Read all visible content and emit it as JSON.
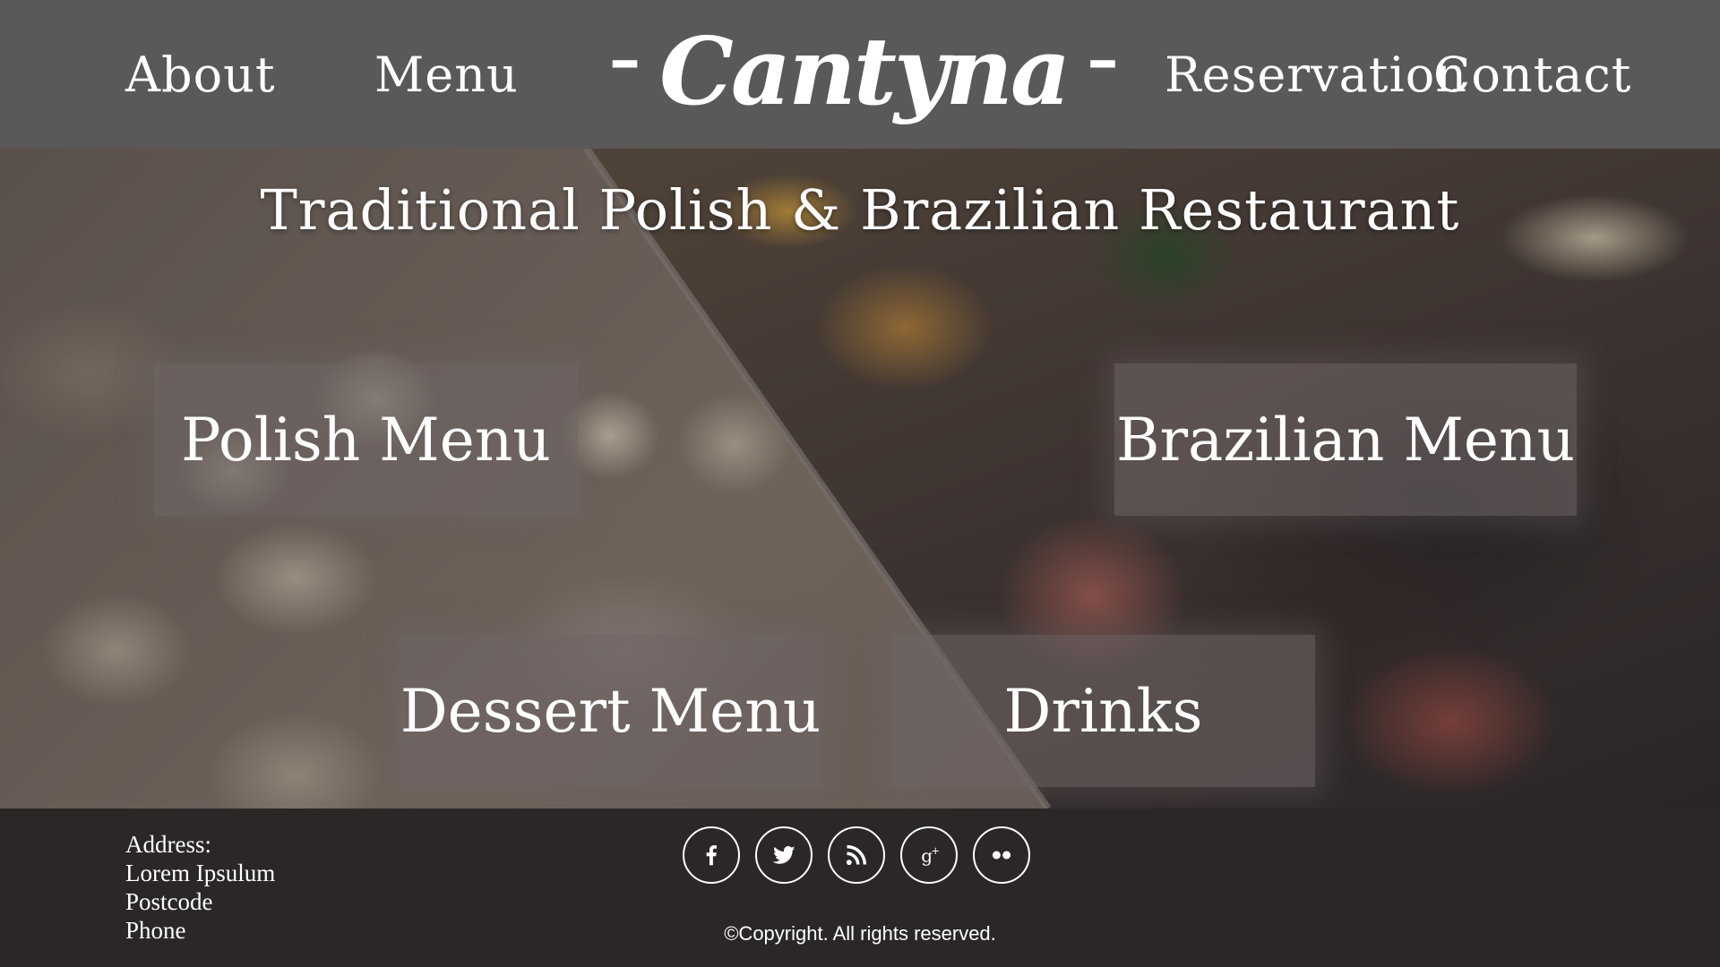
{
  "header": {
    "nav_left": [
      "About",
      "Menu"
    ],
    "logo": "Cantyna",
    "logo_dash": "–",
    "nav_right": [
      "Reservation",
      "Contact"
    ]
  },
  "hero": {
    "title": "Traditional Polish & Brazilian Restaurant",
    "cards": {
      "polish": "Polish Menu",
      "brazilian": "Brazilian Menu",
      "dessert": "Dessert Menu",
      "drinks": "Drinks"
    }
  },
  "footer": {
    "address_label": "Address:",
    "address_lines": [
      "Lorem Ipsulum",
      "Postcode",
      "Phone"
    ],
    "social_icons": [
      "facebook-icon",
      "twitter-icon",
      "rss-icon",
      "google-plus-icon",
      "flickr-icon"
    ],
    "copyright": "©Copyright. All rights reserved."
  },
  "colors": {
    "header_bg": "#5a5859",
    "footer_bg": "#2d2828",
    "text": "#ffffff",
    "card_bg": "#6e6464"
  }
}
